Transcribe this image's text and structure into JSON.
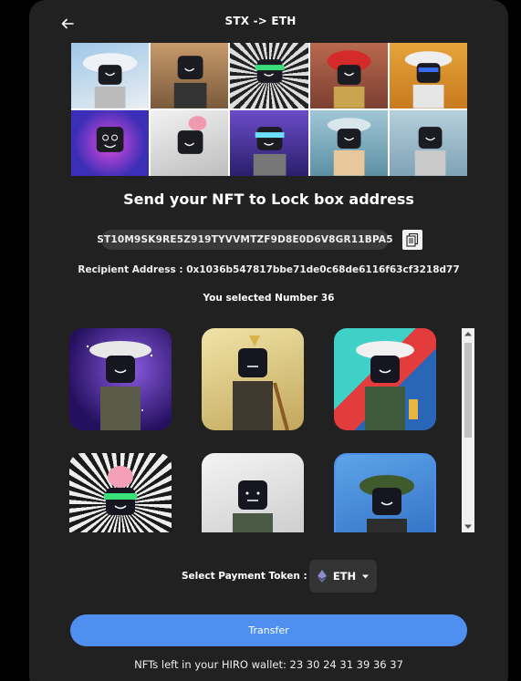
{
  "header": {
    "title": "STX -> ETH"
  },
  "heading": "Send your NFT to Lock box address",
  "lockbox_address": "ST10M9SK9RE5Z919TYVVMTZF9D8E0D6V8GR11BPA5",
  "recipient": "Recipient Address : 0x1036b547817bbe71de0c68de6116f63cf3218d77",
  "selected": "You selected Number 36",
  "payment": {
    "label": "Select Payment Token :",
    "token": "ETH"
  },
  "transfer_label": "Transfer",
  "footer": "NFTs left in your HIRO wallet: 23 30 24 31 39 36 37",
  "icons": {
    "back": "arrow-left-icon",
    "copy": "copy-icon",
    "token": "ethereum-icon",
    "caret": "caret-down-icon"
  },
  "colors": {
    "panel": "#212121",
    "accent": "#4f8ff0",
    "pill": "#3a3a3a"
  }
}
